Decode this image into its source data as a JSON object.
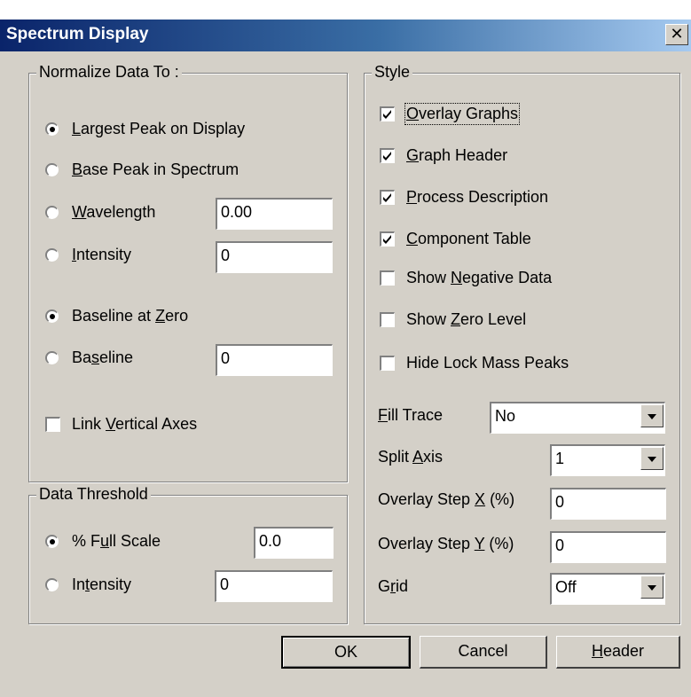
{
  "window": {
    "title": "Spectrum Display",
    "close_glyph": "✕"
  },
  "normalize": {
    "legend": "Normalize Data To :",
    "largest_peak": {
      "label_pre": "",
      "mnemonic": "L",
      "label_post": "argest Peak on Display",
      "selected": true
    },
    "base_peak": {
      "label_pre": "",
      "mnemonic": "B",
      "label_post": "ase Peak in Spectrum",
      "selected": false
    },
    "wavelength": {
      "label_pre": "",
      "mnemonic": "W",
      "label_post": "avelength",
      "selected": false,
      "value": "0.00"
    },
    "intensity": {
      "label_pre": "",
      "mnemonic": "I",
      "label_post": "ntensity",
      "selected": false,
      "value": "0"
    },
    "baseline_zero": {
      "label_pre": "Baseline at ",
      "mnemonic": "Z",
      "label_post": "ero",
      "selected": true
    },
    "baseline": {
      "label_pre": "Ba",
      "mnemonic": "s",
      "label_post": "eline",
      "selected": false,
      "value": "0"
    },
    "link_axes": {
      "label_pre": "Link ",
      "mnemonic": "V",
      "label_post": "ertical Axes",
      "checked": false
    }
  },
  "threshold": {
    "legend": "Data Threshold",
    "full_scale": {
      "label_pre": "% F",
      "mnemonic": "u",
      "label_post": "ll Scale",
      "selected": true,
      "value": "0.0"
    },
    "intensity": {
      "label_pre": "In",
      "mnemonic": "t",
      "label_post": "ensity",
      "selected": false,
      "value": "0"
    }
  },
  "style": {
    "legend": "Style",
    "overlay_graphs": {
      "label_pre": "",
      "mnemonic": "O",
      "label_post": "verlay Graphs",
      "checked": true
    },
    "graph_header": {
      "label_pre": "",
      "mnemonic": "G",
      "label_post": "raph Header",
      "checked": true
    },
    "process_description": {
      "label_pre": "",
      "mnemonic": "P",
      "label_post": "rocess Description",
      "checked": true
    },
    "component_table": {
      "label_pre": "",
      "mnemonic": "C",
      "label_post": "omponent Table",
      "checked": true
    },
    "show_negative": {
      "label_pre": "Show ",
      "mnemonic": "N",
      "label_post": "egative Data",
      "checked": false
    },
    "show_zero": {
      "label_pre": "Show ",
      "mnemonic": "Z",
      "label_post": "ero Level",
      "checked": false
    },
    "hide_lock_mass": {
      "label_pre": "Hide Lock Mass Peaks",
      "mnemonic": "",
      "label_post": "",
      "checked": false
    },
    "fill_trace": {
      "label_pre": "",
      "mnemonic": "F",
      "label_post": "ill Trace",
      "value": "No"
    },
    "split_axis": {
      "label_pre": "Split ",
      "mnemonic": "A",
      "label_post": "xis",
      "value": "1"
    },
    "overlay_step_x": {
      "label_pre": "Overlay Step ",
      "mnemonic": "X",
      "label_post": " (%)",
      "value": "0"
    },
    "overlay_step_y": {
      "label_pre": "Overlay Step ",
      "mnemonic": "Y",
      "label_post": " (%)",
      "value": "0"
    },
    "grid": {
      "label_pre": "G",
      "mnemonic": "r",
      "label_post": "id",
      "value": "Off"
    }
  },
  "buttons": {
    "ok": "OK",
    "cancel": "Cancel",
    "header": {
      "mnemonic": "H",
      "label_post": "eader"
    }
  },
  "colors": {
    "titlebar_start": "#0a246a",
    "titlebar_end": "#a6caf0",
    "face": "#d4d0c8"
  }
}
